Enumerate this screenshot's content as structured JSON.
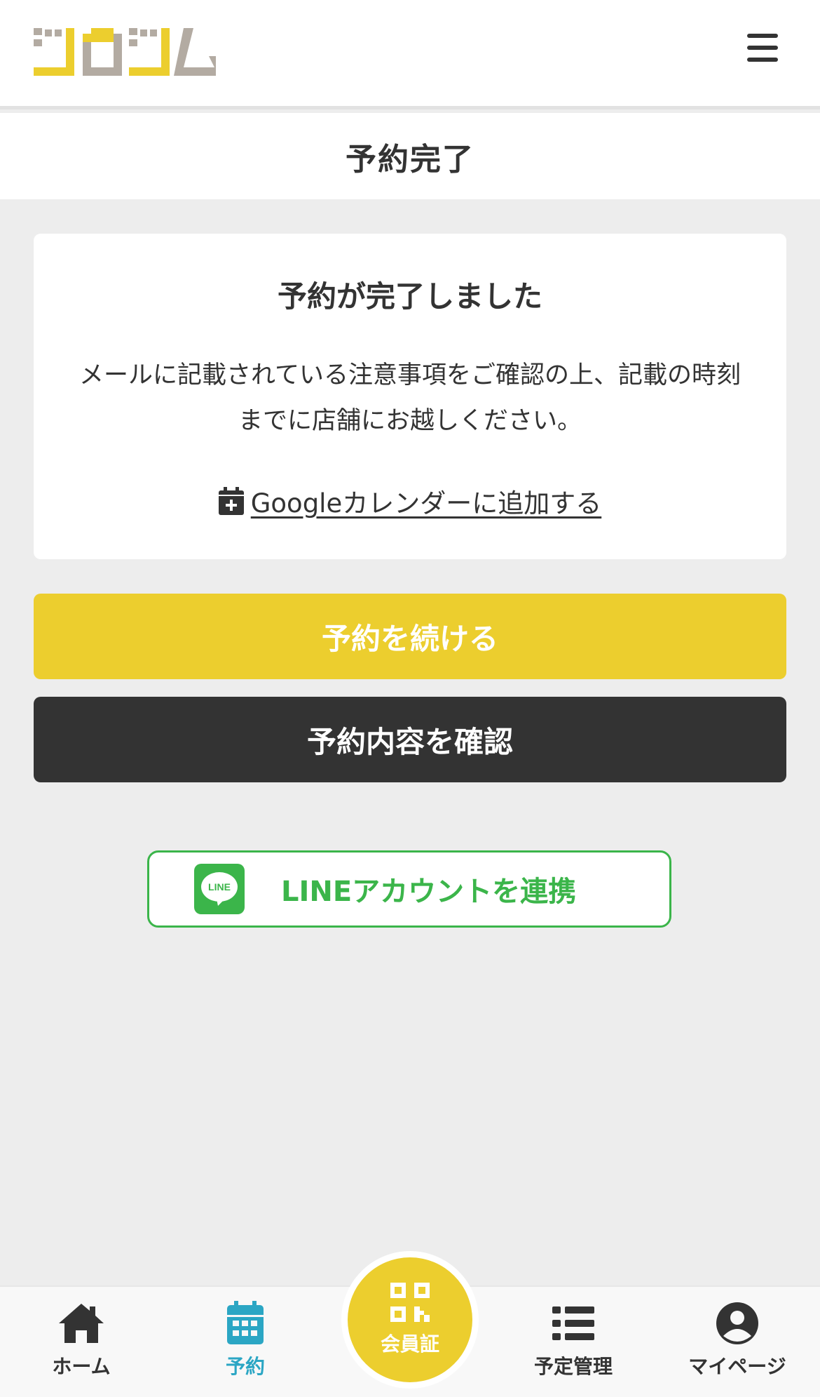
{
  "header": {
    "logo_text": "ジロジム",
    "menu_icon": "hamburger-menu-icon"
  },
  "page": {
    "title": "予約完了"
  },
  "card": {
    "heading": "予約が完了しました",
    "message": "メールに記載されている注意事項をご確認の上、記載の時刻までに店舗にお越しください。",
    "calendar_link": "Googleカレンダーに追加する",
    "calendar_icon": "calendar-plus-icon"
  },
  "buttons": {
    "continue_label": "予約を続ける",
    "confirm_label": "予約内容を確認",
    "line_label": "LINEアカウントを連携",
    "line_icon_text": "LINE"
  },
  "nav": {
    "home": "ホーム",
    "reserve": "予約",
    "member_card": "会員証",
    "schedule": "予定管理",
    "mypage": "マイページ"
  },
  "colors": {
    "accent_yellow": "#ecce2e",
    "dark": "#333333",
    "line_green": "#3bb54a",
    "active_blue": "#2ba6c4",
    "logo_gray": "#b3aba2"
  }
}
